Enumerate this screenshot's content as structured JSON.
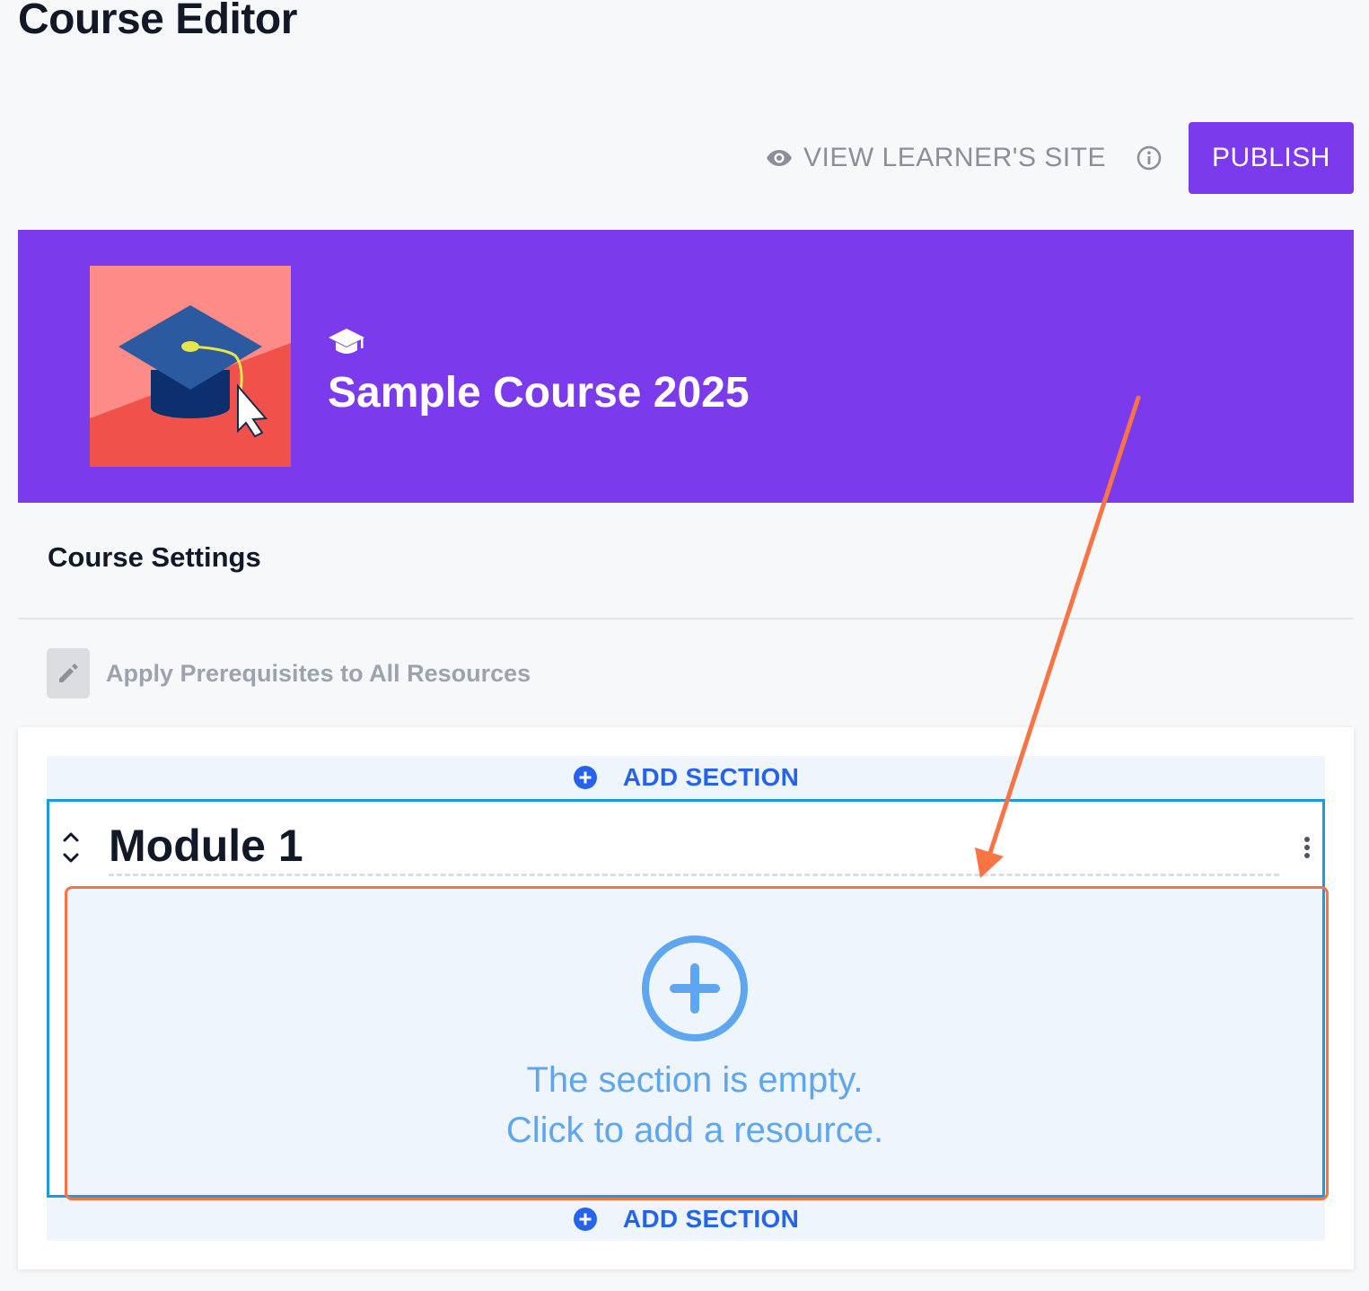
{
  "page": {
    "title": "Course Editor"
  },
  "toolbar": {
    "view_site_label": "VIEW LEARNER'S SITE",
    "publish_label": "PUBLISH",
    "icons": {
      "view": "eye-icon",
      "info": "info-icon"
    }
  },
  "banner": {
    "course_title": "Sample Course 2025",
    "background_color": "#7c3aed",
    "thumbnail": "graduation-cap-with-cursor",
    "type_icon": "graduation-cap-icon"
  },
  "settings": {
    "heading": "Course Settings",
    "prerequisites_label": "Apply Prerequisites to All Resources"
  },
  "sections": {
    "add_section_label": "ADD SECTION",
    "module": {
      "title": "Module 1",
      "empty_line1": "The section is empty.",
      "empty_line2": "Click to add a resource."
    }
  },
  "colors": {
    "accent": "#7c3aed",
    "link_blue": "#2563eb",
    "selection_border": "#1a9be0",
    "annotation": "#f97444"
  }
}
